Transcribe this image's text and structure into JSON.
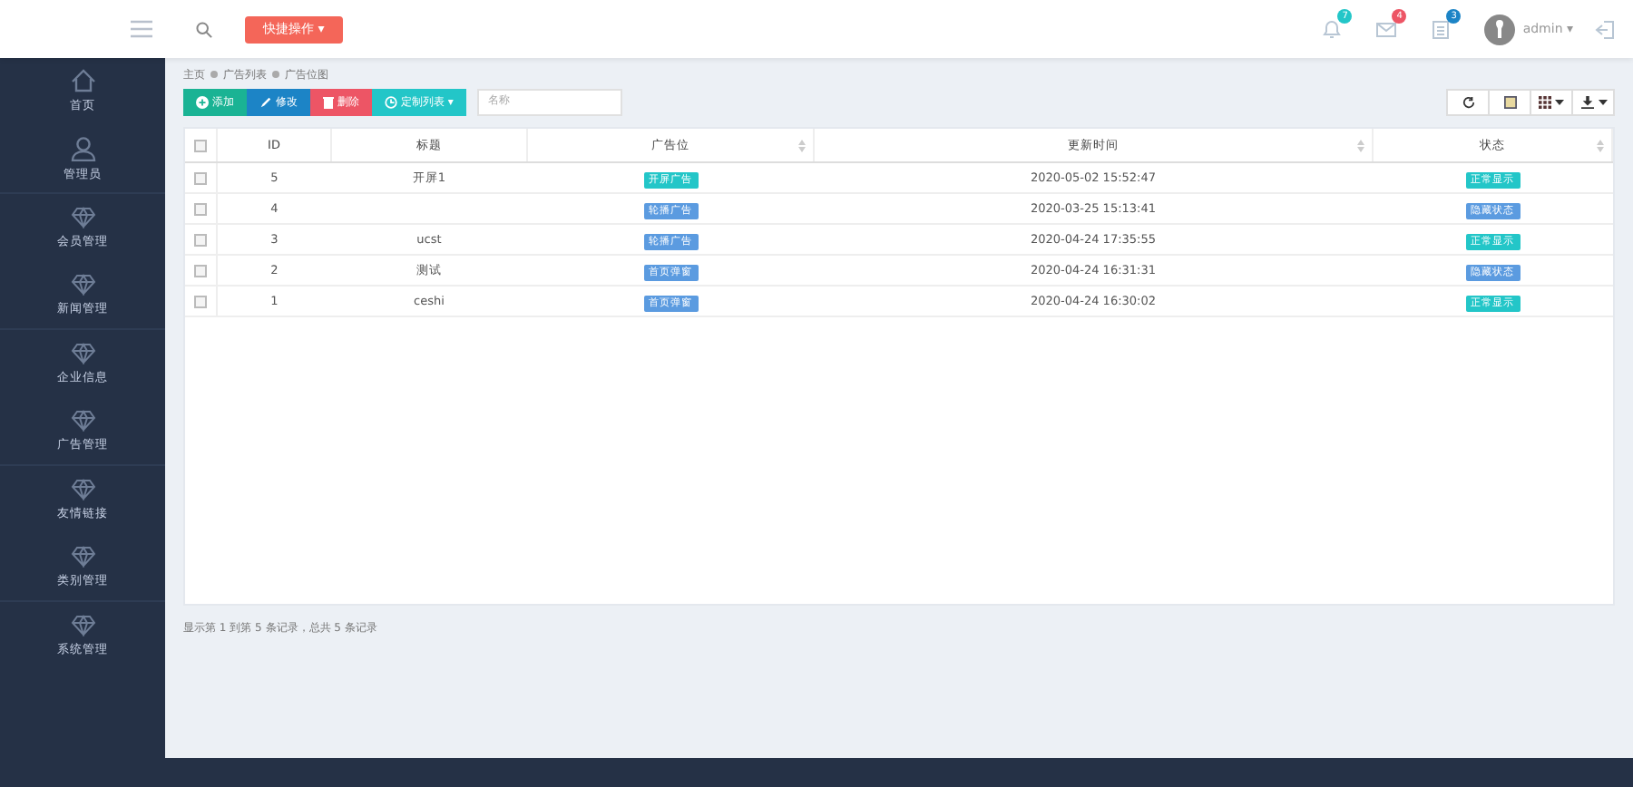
{
  "topbar": {
    "quick_button": "快捷操作 ▾",
    "badges": [
      {
        "count": "7",
        "color": "#23c6c8"
      },
      {
        "count": "4",
        "color": "#ed5565"
      },
      {
        "count": "3",
        "color": "#1c84c6"
      }
    ],
    "user": "admin ▾"
  },
  "sidebar": {
    "items": [
      {
        "label": "首页",
        "kind": "home",
        "selected": false
      },
      {
        "label": "管理员",
        "kind": "user",
        "selected": false
      },
      {
        "label": "会员管理",
        "kind": "module",
        "selected": false
      },
      {
        "label": "新闻管理",
        "kind": "module",
        "selected": false
      },
      {
        "label": "企业信息",
        "kind": "module",
        "selected": false
      },
      {
        "label": "广告管理",
        "kind": "module",
        "selected": false
      },
      {
        "label": "友情链接",
        "kind": "module",
        "selected": false
      },
      {
        "label": "类别管理",
        "kind": "module",
        "selected": false
      },
      {
        "label": "系统管理",
        "kind": "module",
        "selected": false
      }
    ]
  },
  "breadcrumb": [
    "主页",
    "广告列表",
    "广告位图"
  ],
  "toolbar": {
    "buttons": [
      {
        "label": "添加",
        "kind": "add"
      },
      {
        "label": "修改",
        "kind": "edit"
      },
      {
        "label": "删除",
        "kind": "delete"
      },
      {
        "label": "定制列表 ▾",
        "kind": "custom"
      }
    ],
    "search": {
      "placeholder": "名称"
    }
  },
  "table": {
    "all_checked": false,
    "columns": [
      {
        "label": "ID",
        "sortable": false
      },
      {
        "label": "标题",
        "sortable": false
      },
      {
        "label": "广告位",
        "sortable": true
      },
      {
        "label": "更新时间",
        "sortable": true
      },
      {
        "label": "状态",
        "sortable": true
      }
    ],
    "rows": [
      {
        "checked": false,
        "id": "5",
        "title": "开屏1",
        "position": {
          "label": "开屏广告",
          "color": "#23c6c8"
        },
        "time": "2020-05-02 15:52:47",
        "status": {
          "label": "正常显示",
          "color": "#23c6c8"
        }
      },
      {
        "checked": false,
        "id": "4",
        "title": "",
        "position": {
          "label": "轮播广告",
          "color": "#5b9be0"
        },
        "time": "2020-03-25 15:13:41",
        "status": {
          "label": "隐藏状态",
          "color": "#5b9be0"
        }
      },
      {
        "checked": false,
        "id": "3",
        "title": "ucst",
        "position": {
          "label": "轮播广告",
          "color": "#5b9be0"
        },
        "time": "2020-04-24 17:35:55",
        "status": {
          "label": "正常显示",
          "color": "#23c6c8"
        }
      },
      {
        "checked": false,
        "id": "2",
        "title": "测试",
        "position": {
          "label": "首页弹窗",
          "color": "#5b9be0"
        },
        "time": "2020-04-24 16:31:31",
        "status": {
          "label": "隐藏状态",
          "color": "#5b9be0"
        }
      },
      {
        "checked": false,
        "id": "1",
        "title": "ceshi",
        "position": {
          "label": "首页弹窗",
          "color": "#5b9be0"
        },
        "time": "2020-04-24 16:30:02",
        "status": {
          "label": "正常显示",
          "color": "#23c6c8"
        }
      }
    ]
  },
  "pagination": "显示第 1 到第 5 条记录，总共 5 条记录"
}
